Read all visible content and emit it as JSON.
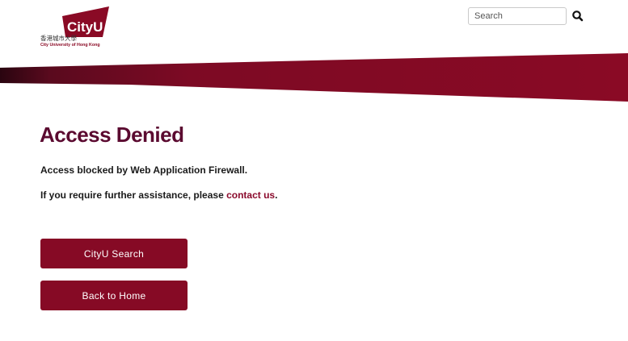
{
  "header": {
    "logo": {
      "mark_text": "CityU",
      "chinese_text": "香港城市大學",
      "english_text": "City University of Hong Kong"
    },
    "search": {
      "placeholder": "Search",
      "value": "",
      "icon": "search-icon"
    }
  },
  "main": {
    "title": "Access Denied",
    "message": "Access blocked by Web Application Firewall.",
    "assist_prefix": "If you require further assistance, please ",
    "contact_link": "contact us",
    "assist_suffix": "."
  },
  "buttons": {
    "search_label": "CityU Search",
    "home_label": "Back to Home"
  },
  "colors": {
    "brand": "#860a25",
    "title": "#5b0a30",
    "link": "#8b0a2c"
  }
}
